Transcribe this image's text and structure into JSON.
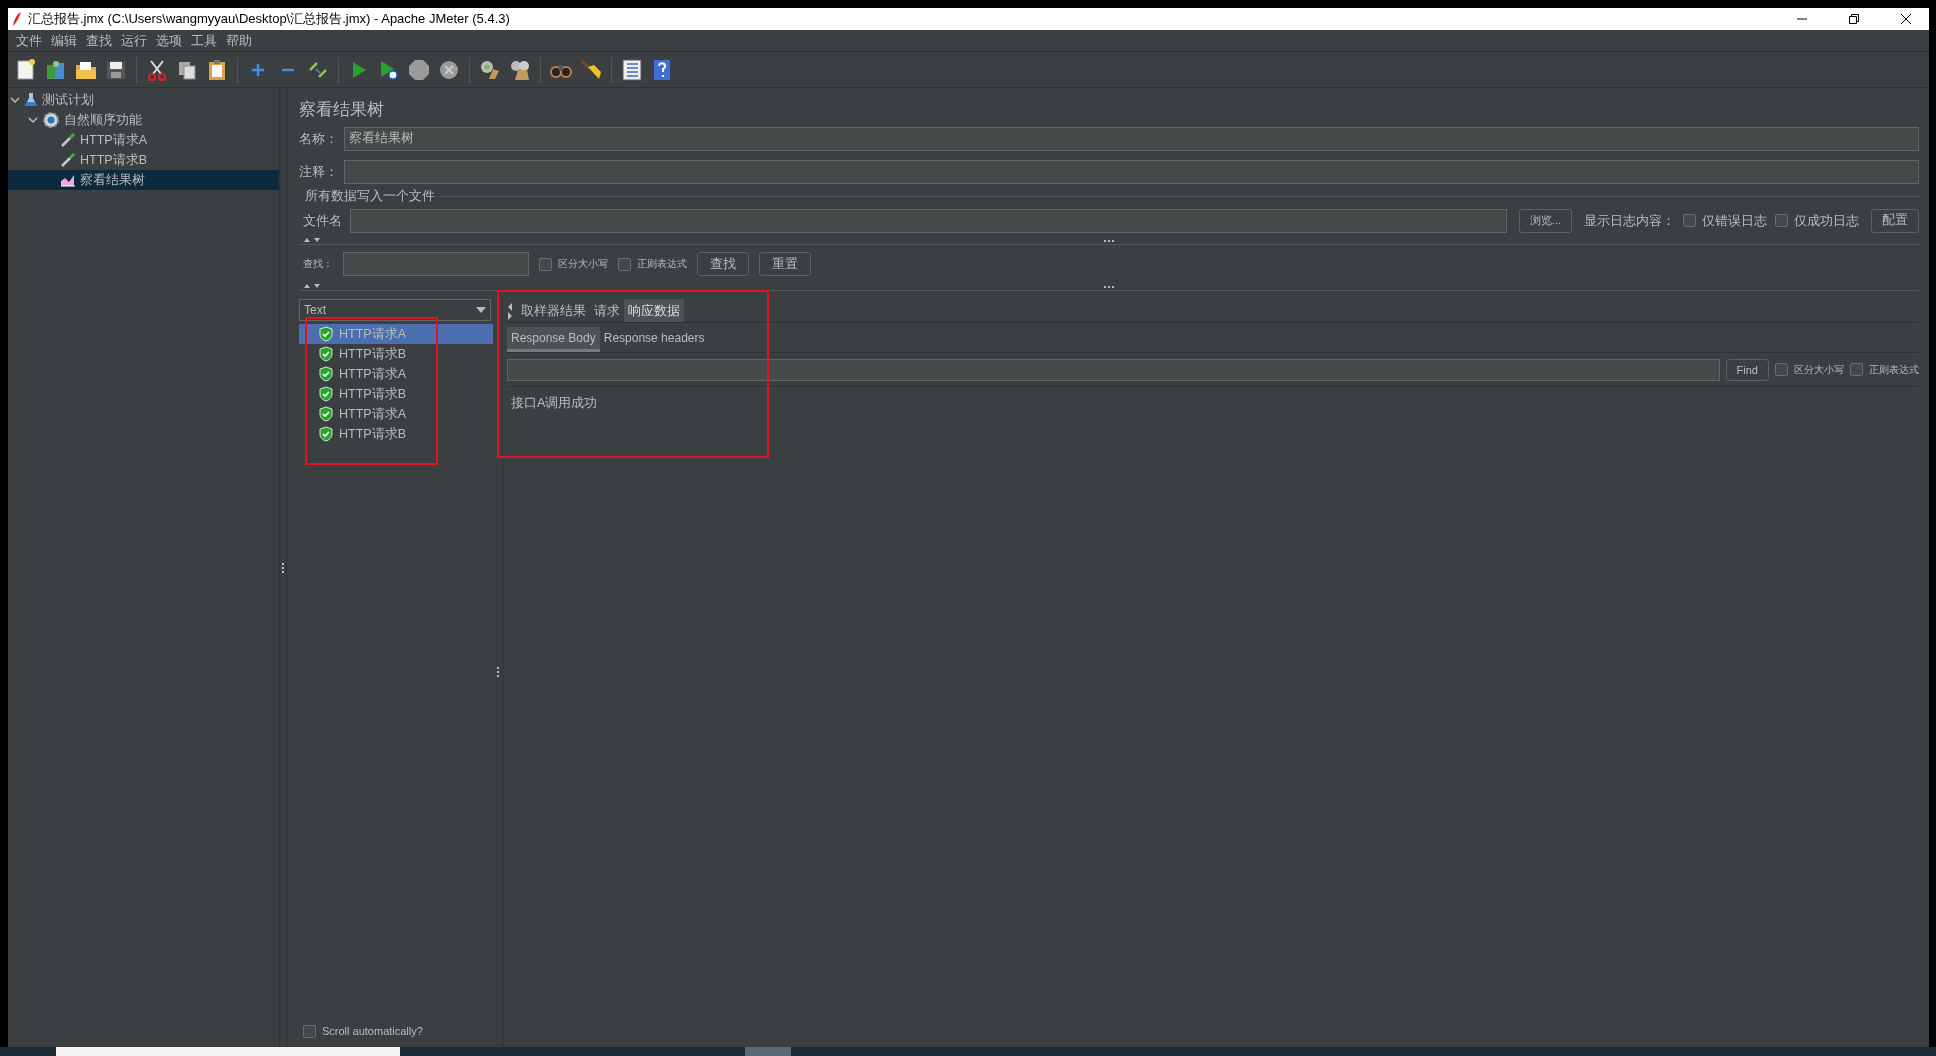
{
  "window": {
    "title": "汇总报告.jmx (C:\\Users\\wangmyyau\\Desktop\\汇总报告.jmx) - Apache JMeter (5.4.3)"
  },
  "menu": [
    "文件",
    "编辑",
    "查找",
    "运行",
    "选项",
    "工具",
    "帮助"
  ],
  "tree": [
    {
      "label": "测试计划",
      "kind": "plan",
      "selected": false,
      "expanded": true,
      "children": [
        {
          "label": "自然顺序功能",
          "kind": "controller",
          "selected": false,
          "expanded": true,
          "children": [
            {
              "label": "HTTP请求A",
              "kind": "sampler",
              "selected": false
            },
            {
              "label": "HTTP请求B",
              "kind": "sampler",
              "selected": false
            },
            {
              "label": "察看结果树",
              "kind": "listener",
              "selected": true
            }
          ]
        }
      ]
    }
  ],
  "panel": {
    "title": "察看结果树",
    "name_label": "名称：",
    "name_value": "察看结果树",
    "comment_label": "注释：",
    "file_group": "所有数据写入一个文件",
    "file_label": "文件名",
    "browse": "浏览...",
    "log_label": "显示日志内容：",
    "log_options": [
      {
        "label": "仅错误日志",
        "checked": false
      },
      {
        "label": "仅成功日志",
        "checked": false
      }
    ],
    "config": "配置"
  },
  "search": {
    "label": "查找：",
    "options": [
      {
        "label": "区分大小写",
        "checked": false
      },
      {
        "label": "正则表达式",
        "checked": false
      }
    ],
    "buttons": [
      "查找",
      "重置"
    ]
  },
  "results": {
    "renderer": "Text",
    "items": [
      {
        "label": "HTTP请求A",
        "selected": true,
        "success": true
      },
      {
        "label": "HTTP请求B",
        "selected": false,
        "success": true
      },
      {
        "label": "HTTP请求A",
        "selected": false,
        "success": true
      },
      {
        "label": "HTTP请求B",
        "selected": false,
        "success": true
      },
      {
        "label": "HTTP请求A",
        "selected": false,
        "success": true
      },
      {
        "label": "HTTP请求B",
        "selected": false,
        "success": true
      }
    ],
    "scroll_auto": {
      "label": "Scroll automatically?",
      "checked": false
    }
  },
  "tabs": [
    {
      "label": "取样器结果",
      "selected": false
    },
    {
      "label": "请求",
      "selected": false
    },
    {
      "label": "响应数据",
      "selected": true
    }
  ],
  "subtabs": [
    {
      "label": "Response Body",
      "selected": true
    },
    {
      "label": "Response headers",
      "selected": false
    }
  ],
  "find": {
    "button": "Find",
    "options": [
      {
        "label": "区分大小写",
        "checked": false
      },
      {
        "label": "正则表达式",
        "checked": false
      }
    ]
  },
  "response_text": "接口A调用成功"
}
